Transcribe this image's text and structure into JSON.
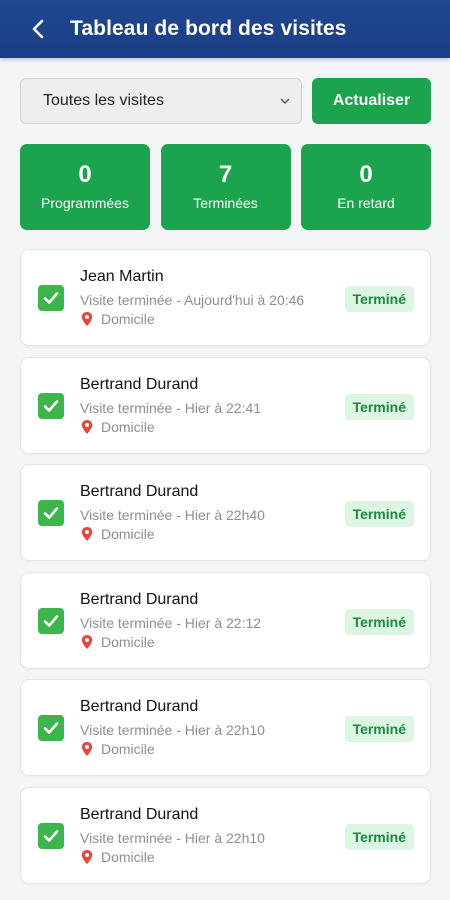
{
  "header": {
    "title": "Tableau de bord des visites"
  },
  "filter": {
    "selected": "Toutes les visites",
    "refresh_label": "Actualiser"
  },
  "stats": [
    {
      "value": "0",
      "label": "Programmées"
    },
    {
      "value": "7",
      "label": "Terminées"
    },
    {
      "value": "0",
      "label": "En retard"
    }
  ],
  "visits": [
    {
      "name": "Jean Martin",
      "desc": "Visite terminée - Aujourd'hui à 20:46",
      "place": "Domicile",
      "status": "Terminé"
    },
    {
      "name": "Bertrand Durand",
      "desc": "Visite terminée - Hier à 22:41",
      "place": "Domicile",
      "status": "Terminé"
    },
    {
      "name": "Bertrand Durand",
      "desc": "Visite terminée - Hier à 22h40",
      "place": "Domicile",
      "status": "Terminé"
    },
    {
      "name": "Bertrand Durand",
      "desc": "Visite terminée - Hier à 22:12",
      "place": "Domicile",
      "status": "Terminé"
    },
    {
      "name": "Bertrand Durand",
      "desc": "Visite terminée - Hier à 22h10",
      "place": "Domicile",
      "status": "Terminé"
    },
    {
      "name": "Bertrand Durand",
      "desc": "Visite terminée - Hier à 22h10",
      "place": "Domicile",
      "status": "Terminé"
    }
  ],
  "colors": {
    "header": "#1f4690",
    "primary": "#1ba44d",
    "badge_bg": "#ddf5e3",
    "badge_text": "#1a8a3e"
  },
  "icons": {
    "back": "back-arrow-icon",
    "check": "check-box-icon",
    "pin": "location-pin-icon",
    "dropdown": "chevron-down-icon"
  }
}
